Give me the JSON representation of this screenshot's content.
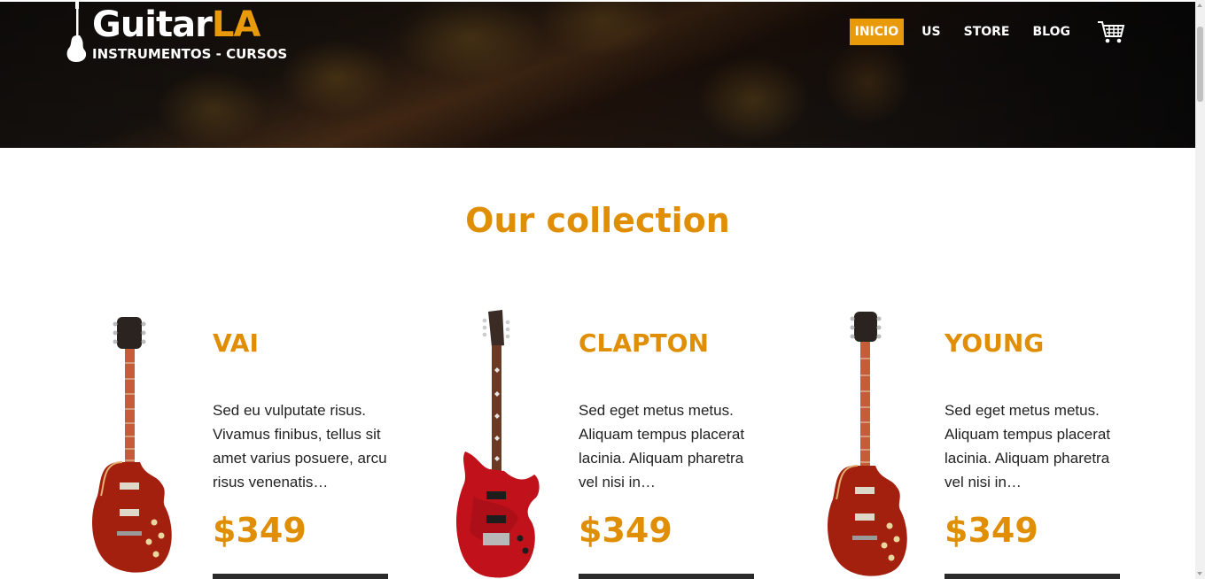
{
  "header": {
    "brand": {
      "main": "Guitar",
      "accent": "LA",
      "subtitle": "INSTRUMENTOS - CURSOS"
    },
    "nav": [
      {
        "label": "INICIO",
        "active": true
      },
      {
        "label": "US",
        "active": false
      },
      {
        "label": "STORE",
        "active": false
      },
      {
        "label": "BLOG",
        "active": false
      }
    ],
    "cart_icon": "cart-icon"
  },
  "main": {
    "title": "Our collection",
    "products": [
      {
        "name": "VAI",
        "description": "Sed eu vulputate risus. Vivamus finibus, tellus sit amet varius posuere, arcu risus venenatis…",
        "price": "$349",
        "image": "guitar-les-paul"
      },
      {
        "name": "CLAPTON",
        "description": "Sed eget metus metus. Aliquam tempus placerat lacinia. Aliquam pharetra vel nisi in…",
        "price": "$349",
        "image": "guitar-superstrat"
      },
      {
        "name": "YOUNG",
        "description": "Sed eget metus metus. Aliquam tempus placerat lacinia. Aliquam pharetra vel nisi in…",
        "price": "$349",
        "image": "guitar-les-paul"
      }
    ]
  },
  "colors": {
    "accent": "#e99a0b",
    "title": "#e08f05",
    "text": "#222222",
    "dark": "#2b2b2b"
  }
}
